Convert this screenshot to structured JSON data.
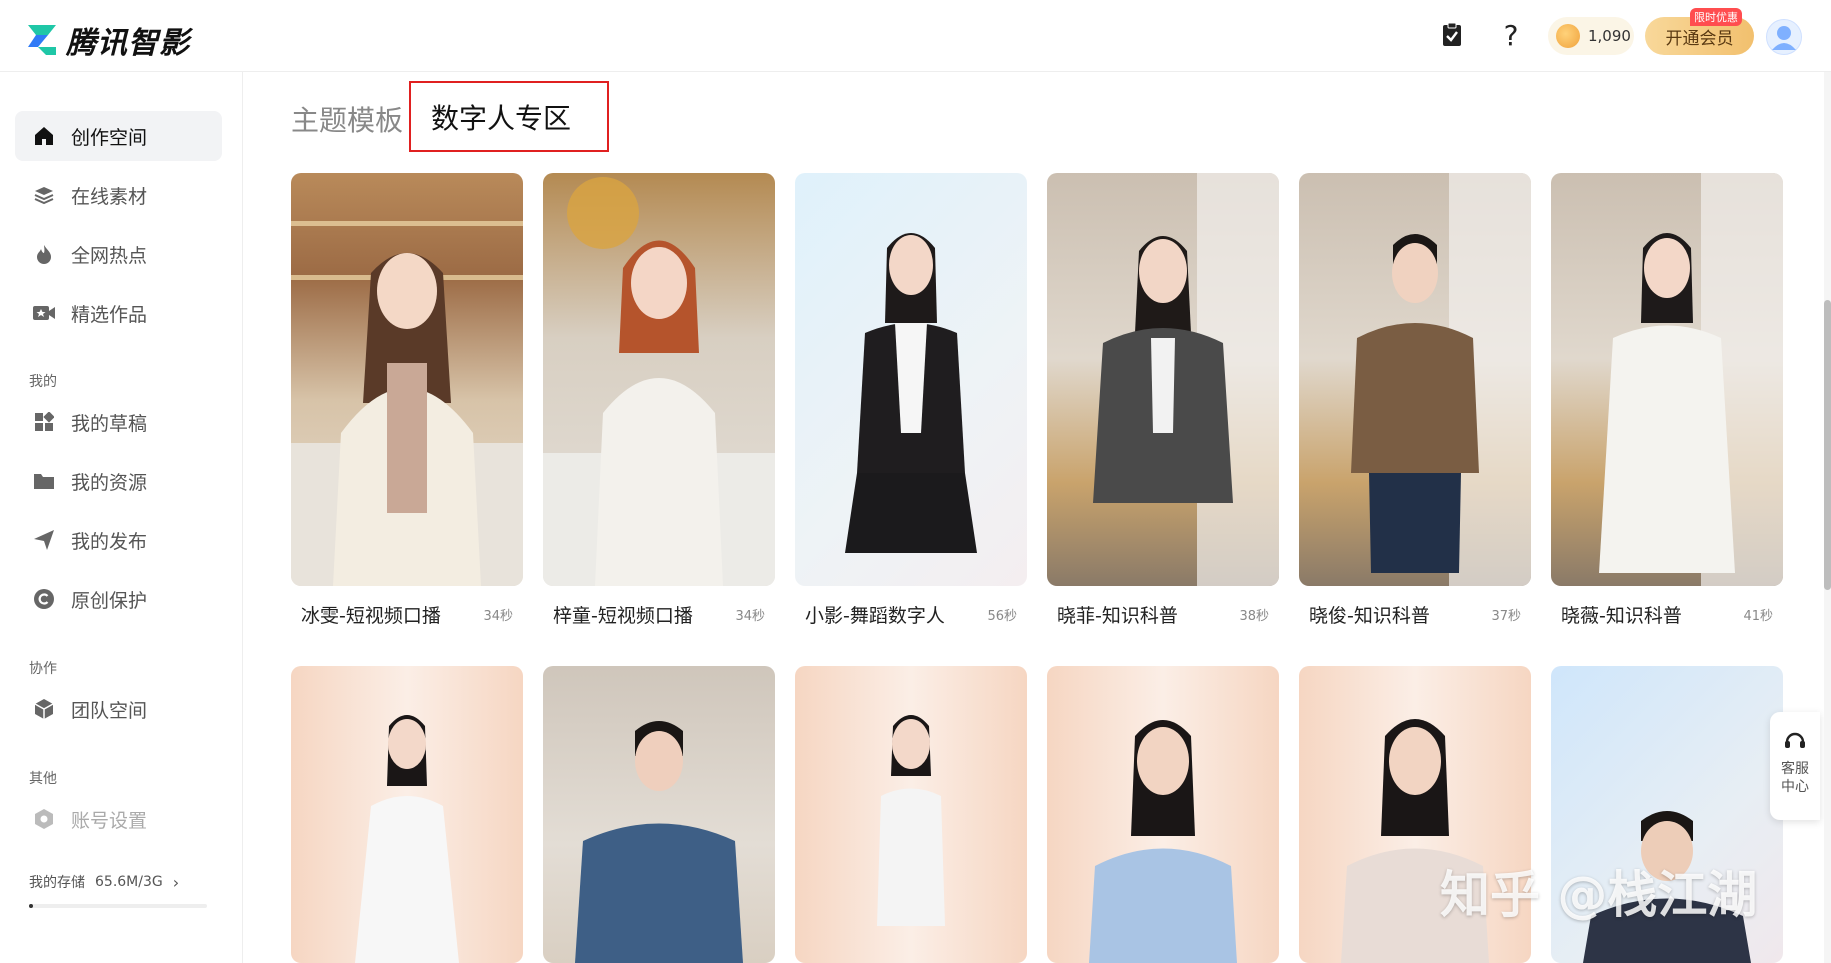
{
  "app": {
    "name": "腾讯智影",
    "colors": {
      "brand": "#12c2a0",
      "accent": "#f2c06e",
      "highlight_border": "#e02020"
    }
  },
  "topbar": {
    "icons": [
      "clipboard-check-icon",
      "help-icon"
    ],
    "coins": "1,090",
    "vip_label": "开通会员",
    "vip_badge": "限时优惠"
  },
  "sidebar": {
    "items": [
      {
        "label": "创作空间",
        "icon": "home-icon",
        "active": true
      },
      {
        "label": "在线素材",
        "icon": "layers-icon"
      },
      {
        "label": "全网热点",
        "icon": "flame-icon"
      },
      {
        "label": "精选作品",
        "icon": "video-star-icon"
      }
    ],
    "section_mine": "我的",
    "mine_items": [
      {
        "label": "我的草稿",
        "icon": "grid-icon"
      },
      {
        "label": "我的资源",
        "icon": "folder-icon"
      },
      {
        "label": "我的发布",
        "icon": "send-icon"
      },
      {
        "label": "原创保护",
        "icon": "copyright-icon"
      }
    ],
    "section_collab": "协作",
    "collab_items": [
      {
        "label": "团队空间",
        "icon": "cube-icon"
      }
    ],
    "section_other": "其他",
    "other_items": [
      {
        "label": "账号设置",
        "icon": "hexagon-settings-icon",
        "disabled": true
      }
    ],
    "storage_label": "我的存储",
    "storage_value": "65.6M/3G",
    "storage_fraction": 0.02
  },
  "main": {
    "tabs": [
      {
        "label": "主题模板"
      },
      {
        "label": "数字人专区",
        "active": true
      }
    ],
    "row1": [
      {
        "name": "冰雯-短视频口播",
        "duration": "34秒"
      },
      {
        "name": "梓童-短视频口播",
        "duration": "34秒"
      },
      {
        "name": "小影-舞蹈数字人",
        "duration": "56秒"
      },
      {
        "name": "晓菲-知识科普",
        "duration": "38秒"
      },
      {
        "name": "晓俊-知识科普",
        "duration": "37秒"
      },
      {
        "name": "晓薇-知识科普",
        "duration": "41秒"
      }
    ]
  },
  "service": {
    "label": "客服中心",
    "icon": "headset-icon"
  },
  "watermark": "知乎 @栈江湖"
}
